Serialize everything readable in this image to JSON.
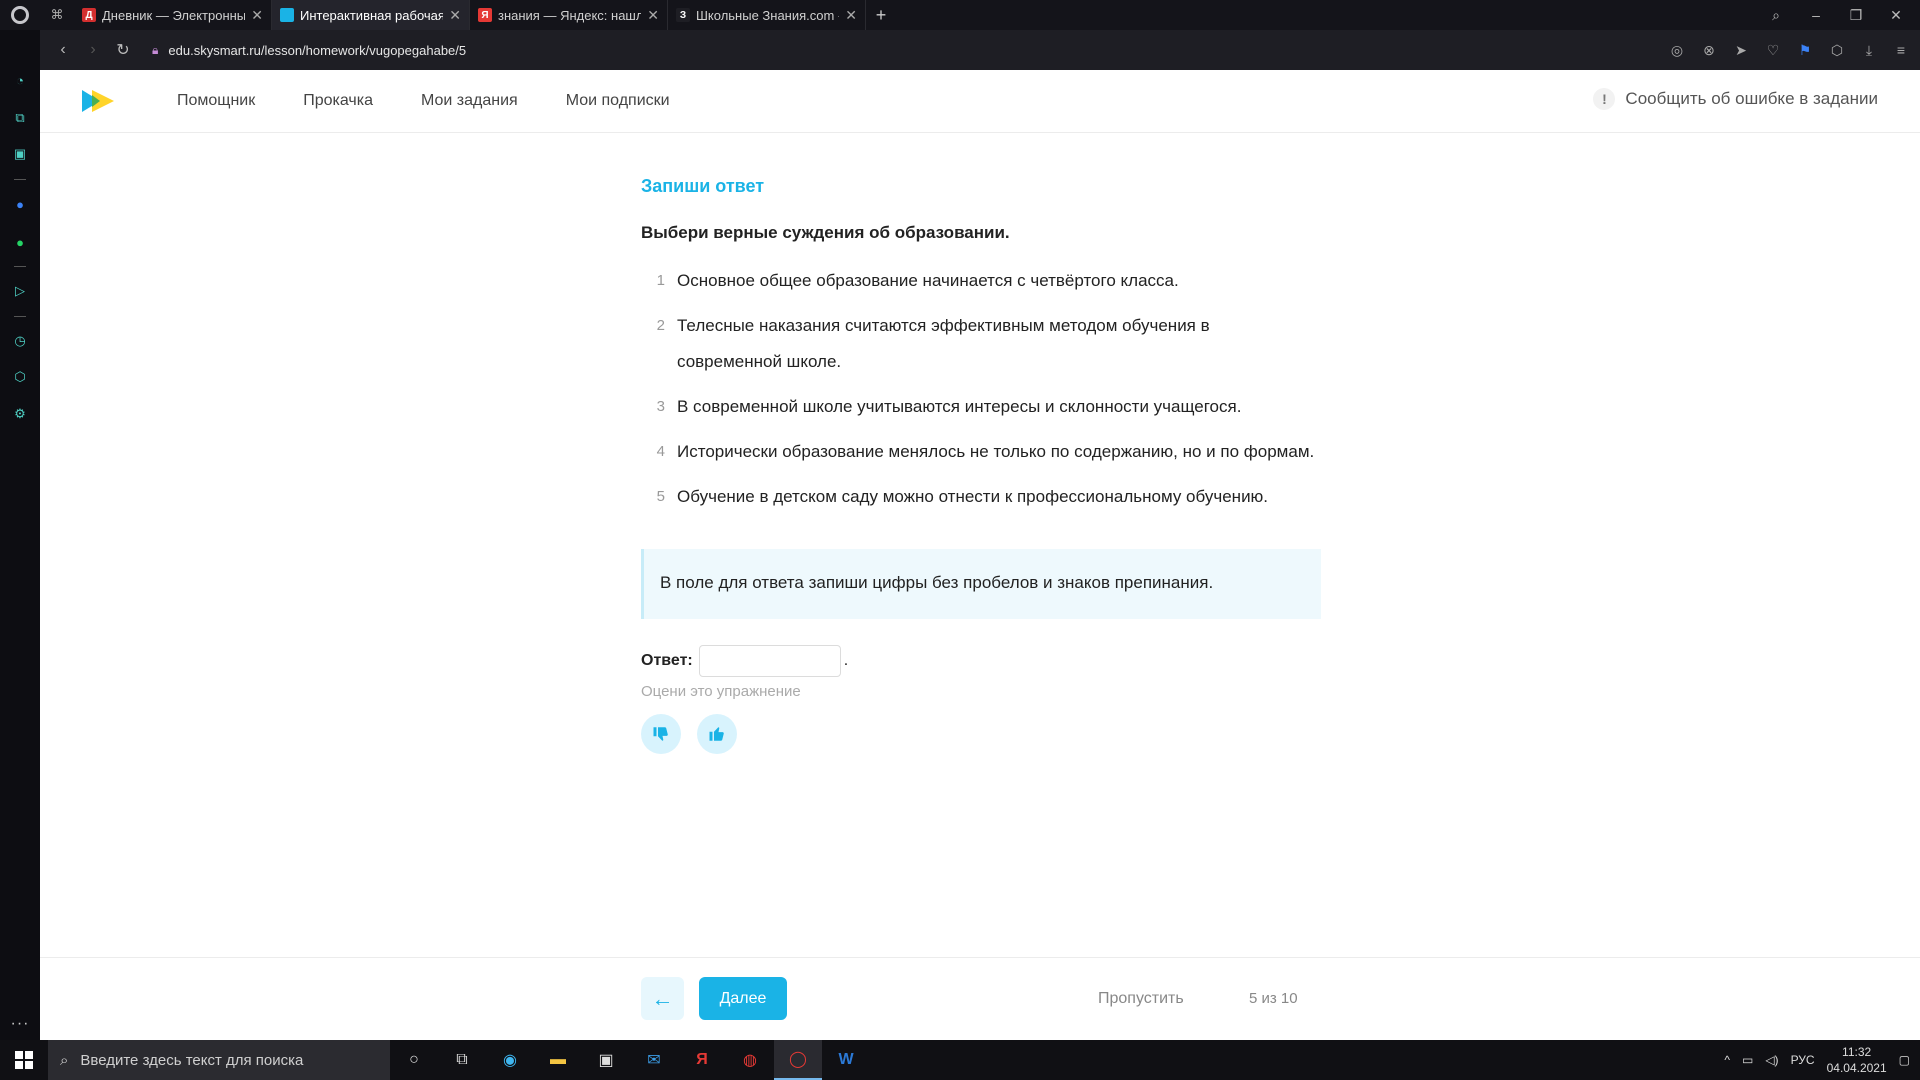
{
  "browser": {
    "tabs": [
      {
        "title": "Дневник — Электронный",
        "favicon_color": "#d32f2f",
        "favicon_letter": "Д",
        "active": false
      },
      {
        "title": "Интерактивная рабочая т",
        "favicon_color": "#1ab3e6",
        "favicon_letter": "",
        "active": true
      },
      {
        "title": "знания — Яндекс: нашлос",
        "favicon_color": "#e53935",
        "favicon_letter": "Я",
        "active": false
      },
      {
        "title": "Школьные Знания.com - :",
        "favicon_color": "#1e1e24",
        "favicon_letter": "З",
        "active": false
      }
    ],
    "url": "edu.skysmart.ru/lesson/homework/vugopegahabe/5"
  },
  "header": {
    "menu": [
      "Помощник",
      "Прокачка",
      "Мои задания",
      "Мои подписки"
    ],
    "report_label": "Сообщить об ошибке в задании",
    "report_icon": "!"
  },
  "task": {
    "type_label": "Запиши ответ",
    "question": "Выбери верные суждения об образовании.",
    "items": [
      {
        "num": "1",
        "text": "Основное общее образование начинается с четвёртого класса."
      },
      {
        "num": "2",
        "text": "Телесные наказания считаются эффективным методом обучения в современной школе."
      },
      {
        "num": "3",
        "text": "В современной школе учитываются интересы и склонности учащегося."
      },
      {
        "num": "4",
        "text": "Исторически образование менялось не только по содержанию, но и по формам."
      },
      {
        "num": "5",
        "text": "Обучение в детском саду можно отнести к профессиональному обучению."
      }
    ],
    "hint": "В поле для ответа запиши цифры без пробелов и знаков препинания.",
    "answer_label": "Ответ:",
    "answer_value": "",
    "answer_suffix": ".",
    "rate_label": "Оцени это упражнение"
  },
  "footer": {
    "next_label": "Далее",
    "skip_label": "Пропустить",
    "progress": "5 из 10"
  },
  "taskbar": {
    "search_placeholder": "Введите здесь текст для поиска",
    "language": "РУС",
    "time": "11:32",
    "date": "04.04.2021"
  },
  "colors": {
    "accent": "#1ab3e6",
    "hint_bg": "#eef9fd"
  }
}
